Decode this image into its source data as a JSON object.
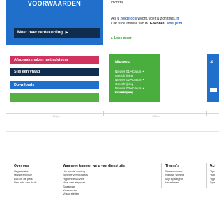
{
  "promo": {
    "title": "VOORWAARDEN",
    "button_label": "Meer over rentekorting",
    "button_icon": "triangle-right-icon"
  },
  "intro": {
    "trail": "dichtbij.",
    "line1_pre": "Als u ",
    "line1_link": "zorgeloos",
    "line1_post": " woont, voelt u zich thuis. ",
    "line1_tail": "N",
    "line2_pre": "Dat is de ambitie van ",
    "line2_bold": "BLG Wonen",
    "line2_post": ". ",
    "line2_link": "Voel je th",
    "more": "▸ Lees meer"
  },
  "actions": [
    "Afspraak maken met adviseur",
    "Stel een vraag",
    "Downloads",
    "..."
  ],
  "news": {
    "title": "Nieuws",
    "items": [
      "Nieuws 01 • Datum • Omschrijving",
      "Nieuws 02 • Datum • Omschrijving",
      "Nieuws 03 • Datum • Omschrijving"
    ],
    "more": "▸ Lees meer"
  },
  "side_block": {
    "title": "A"
  },
  "measure": {
    "label_a": "128px",
    "label_b": "126px",
    "dot": "..."
  },
  "footer": {
    "col1": {
      "title": "Over ons",
      "items": [
        "Organisatie",
        "Missie en visie",
        "BLG in de pers",
        "Van huis aan thuis"
      ]
    },
    "col2": {
      "title": "Waarmee kunnen we u van dienst zijn",
      "items": [
        "Uw eerste woning",
        "Nieuwe verzophasts",
        "Hypotheekadvies",
        "Haal een afspraak",
        "Spaarplan",
        "Verzekeren",
        "Vraag stellen"
      ]
    },
    "col3": {
      "title": "Thema's",
      "items": [
        "Samenwonen",
        "Nieuwe woning",
        "Mijn spaargeld",
        "Verzekeren"
      ]
    },
    "col4": {
      "title": "Act",
      "items": [
        "Opv",
        "Hyp",
        "Hyp",
        "Spa"
      ]
    }
  },
  "colors": {
    "brand_blue": "#1f6fcb",
    "navy": "#0e2d4f",
    "pink": "#d2335e",
    "green": "#4aae3f"
  }
}
